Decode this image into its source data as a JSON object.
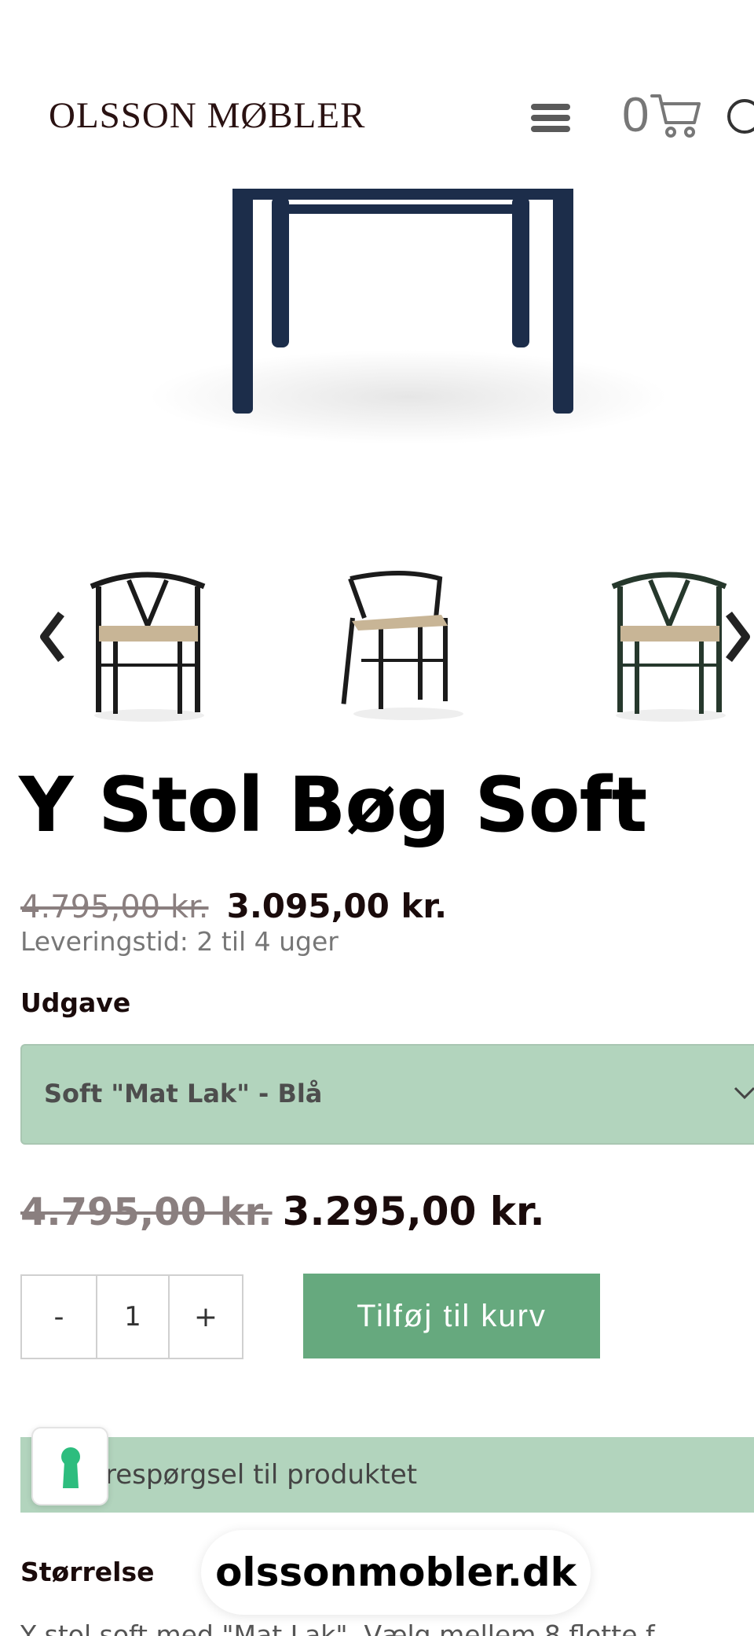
{
  "header": {
    "logo": "OLSSON MØBLER",
    "cart_count": "0",
    "icons": [
      "menu-icon",
      "cart-icon",
      "search-icon"
    ]
  },
  "gallery": {
    "thumbnails": [
      "black chair front",
      "black chair side",
      "green chair front"
    ],
    "icons": [
      "chevron-left-icon",
      "chevron-right-icon"
    ]
  },
  "product": {
    "title": "Y Stol Bøg Soft",
    "old_price": "4.795,00 kr.",
    "new_price": "3.095,00 kr.",
    "delivery": "Leveringstid: 2 til 4 uger",
    "variant_label": "Udgave",
    "variant_selected": "Soft \"Mat Lak\" - Blå",
    "variant_old_price": "4.795,00 kr.",
    "variant_new_price": "3.295,00 kr.",
    "quantity": "1",
    "minus_label": "-",
    "plus_label": "+",
    "add_to_cart": "Tilføj til kurv",
    "inquiry": "respørgsel til produktet",
    "size_label": "Størrelse",
    "description_partial": "Y stol soft med \"Mat Lak\". Vælg mellem 8 flotte f"
  },
  "browser": {
    "domain": "olssonmobler.dk"
  },
  "colors": {
    "accent_green": "#66a97e",
    "light_green": "#b2d4bd",
    "chair_blue": "#1c2d4a"
  }
}
